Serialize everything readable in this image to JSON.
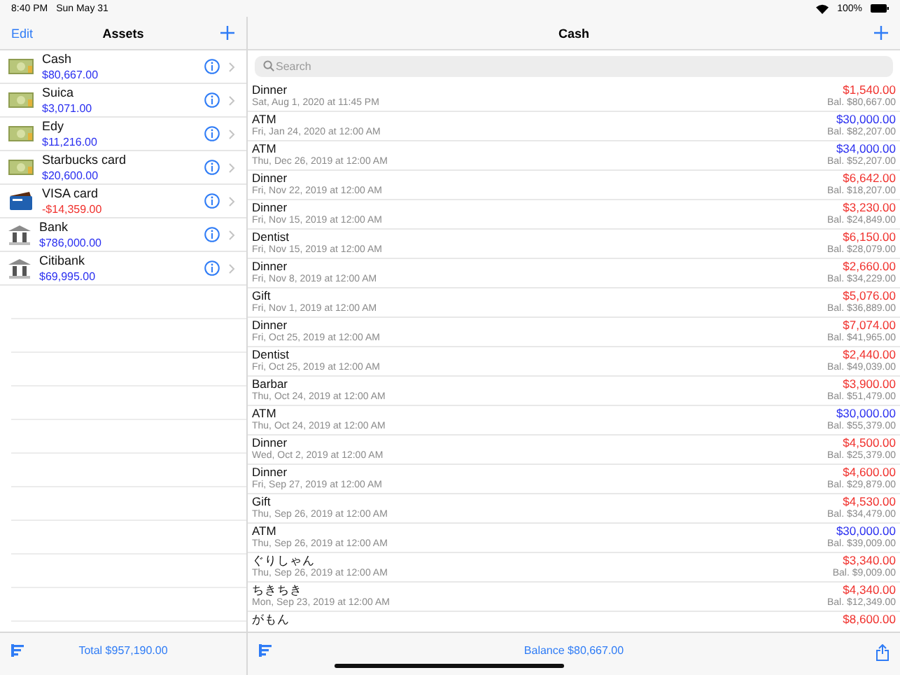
{
  "status_bar": {
    "time": "8:40 PM",
    "date": "Sun May 31",
    "battery": "100%"
  },
  "assets_pane": {
    "edit": "Edit",
    "title": "Assets",
    "items": [
      {
        "name": "Cash",
        "amount": "$80,667.00",
        "kind": "cash",
        "negative": false
      },
      {
        "name": "Suica",
        "amount": "$3,071.00",
        "kind": "cash",
        "negative": false
      },
      {
        "name": "Edy",
        "amount": "$11,216.00",
        "kind": "cash",
        "negative": false
      },
      {
        "name": "Starbucks card",
        "amount": "$20,600.00",
        "kind": "cash",
        "negative": false
      },
      {
        "name": "VISA card",
        "amount": "-$14,359.00",
        "kind": "card",
        "negative": true
      },
      {
        "name": "Bank",
        "amount": "$786,000.00",
        "kind": "bank",
        "negative": false
      },
      {
        "name": "Citibank",
        "amount": "$69,995.00",
        "kind": "bank",
        "negative": false
      }
    ],
    "total": "Total $957,190.00"
  },
  "transactions_pane": {
    "title": "Cash",
    "search": {
      "placeholder": "Search"
    },
    "rows": [
      {
        "title": "Dinner",
        "date": "Sat, Aug 1, 2020 at 11:45 PM",
        "amount": "$1,540.00",
        "income": false,
        "balance": "Bal. $80,667.00"
      },
      {
        "title": "ATM",
        "date": "Fri, Jan 24, 2020 at 12:00 AM",
        "amount": "$30,000.00",
        "income": true,
        "balance": "Bal. $82,207.00"
      },
      {
        "title": "ATM",
        "date": "Thu, Dec 26, 2019 at 12:00 AM",
        "amount": "$34,000.00",
        "income": true,
        "balance": "Bal. $52,207.00"
      },
      {
        "title": "Dinner",
        "date": "Fri, Nov 22, 2019 at 12:00 AM",
        "amount": "$6,642.00",
        "income": false,
        "balance": "Bal. $18,207.00"
      },
      {
        "title": "Dinner",
        "date": "Fri, Nov 15, 2019 at 12:00 AM",
        "amount": "$3,230.00",
        "income": false,
        "balance": "Bal. $24,849.00"
      },
      {
        "title": "Dentist",
        "date": "Fri, Nov 15, 2019 at 12:00 AM",
        "amount": "$6,150.00",
        "income": false,
        "balance": "Bal. $28,079.00"
      },
      {
        "title": "Dinner",
        "date": "Fri, Nov 8, 2019 at 12:00 AM",
        "amount": "$2,660.00",
        "income": false,
        "balance": "Bal. $34,229.00"
      },
      {
        "title": "Gift",
        "date": "Fri, Nov 1, 2019 at 12:00 AM",
        "amount": "$5,076.00",
        "income": false,
        "balance": "Bal. $36,889.00"
      },
      {
        "title": "Dinner",
        "date": "Fri, Oct 25, 2019 at 12:00 AM",
        "amount": "$7,074.00",
        "income": false,
        "balance": "Bal. $41,965.00"
      },
      {
        "title": "Dentist",
        "date": "Fri, Oct 25, 2019 at 12:00 AM",
        "amount": "$2,440.00",
        "income": false,
        "balance": "Bal. $49,039.00"
      },
      {
        "title": "Barbar",
        "date": "Thu, Oct 24, 2019 at 12:00 AM",
        "amount": "$3,900.00",
        "income": false,
        "balance": "Bal. $51,479.00"
      },
      {
        "title": "ATM",
        "date": "Thu, Oct 24, 2019 at 12:00 AM",
        "amount": "$30,000.00",
        "income": true,
        "balance": "Bal. $55,379.00"
      },
      {
        "title": "Dinner",
        "date": "Wed, Oct 2, 2019 at 12:00 AM",
        "amount": "$4,500.00",
        "income": false,
        "balance": "Bal. $25,379.00"
      },
      {
        "title": "Dinner",
        "date": "Fri, Sep 27, 2019 at 12:00 AM",
        "amount": "$4,600.00",
        "income": false,
        "balance": "Bal. $29,879.00"
      },
      {
        "title": "Gift",
        "date": "Thu, Sep 26, 2019 at 12:00 AM",
        "amount": "$4,530.00",
        "income": false,
        "balance": "Bal. $34,479.00"
      },
      {
        "title": "ATM",
        "date": "Thu, Sep 26, 2019 at 12:00 AM",
        "amount": "$30,000.00",
        "income": true,
        "balance": "Bal. $39,009.00"
      },
      {
        "title": "ぐりしゃん",
        "date": "Thu, Sep 26, 2019 at 12:00 AM",
        "amount": "$3,340.00",
        "income": false,
        "balance": "Bal. $9,009.00"
      },
      {
        "title": "ちきちき",
        "date": "Mon, Sep 23, 2019 at 12:00 AM",
        "amount": "$4,340.00",
        "income": false,
        "balance": "Bal. $12,349.00"
      },
      {
        "title": "がもん",
        "amount": "$8,600.00",
        "income": false
      }
    ],
    "balance": "Balance $80,667.00"
  }
}
